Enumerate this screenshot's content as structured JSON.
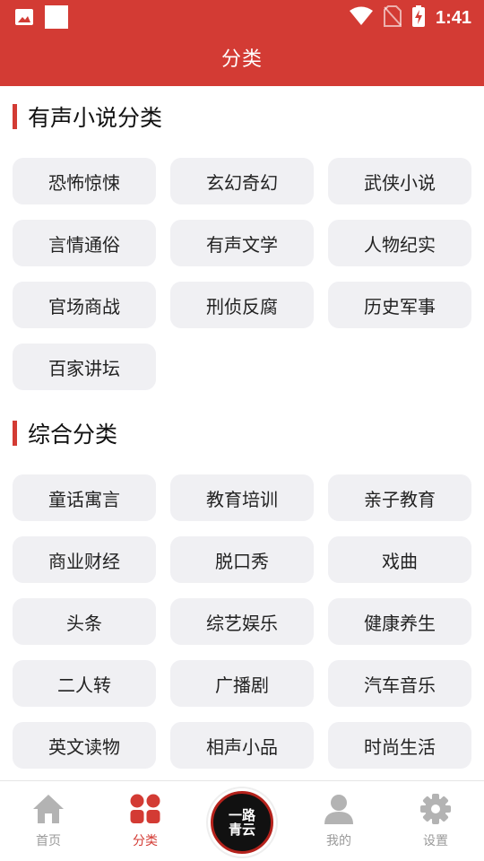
{
  "status_bar": {
    "time": "1:41"
  },
  "app_bar": {
    "title": "分类"
  },
  "sections": [
    {
      "title": "有声小说分类",
      "items": [
        "恐怖惊悚",
        "玄幻奇幻",
        "武侠小说",
        "言情通俗",
        "有声文学",
        "人物纪实",
        "官场商战",
        "刑侦反腐",
        "历史军事",
        "百家讲坛"
      ]
    },
    {
      "title": "综合分类",
      "items": [
        "童话寓言",
        "教育培训",
        "亲子教育",
        "商业财经",
        "脱口秀",
        "戏曲",
        "头条",
        "综艺娱乐",
        "健康养生",
        "二人转",
        "广播剧",
        "汽车音乐",
        "英文读物",
        "相声小品",
        "时尚生活"
      ]
    }
  ],
  "bottom_nav": {
    "items": [
      {
        "label": "首页",
        "icon": "home-icon"
      },
      {
        "label": "分类",
        "icon": "category-icon",
        "active": true
      },
      {
        "label": "我的",
        "icon": "user-icon"
      },
      {
        "label": "设置",
        "icon": "settings-icon"
      }
    ],
    "center_text": "一路青云"
  },
  "colors": {
    "accent": "#d33b34",
    "chip_bg": "#f0f0f3",
    "inactive": "#9a9a9a"
  }
}
